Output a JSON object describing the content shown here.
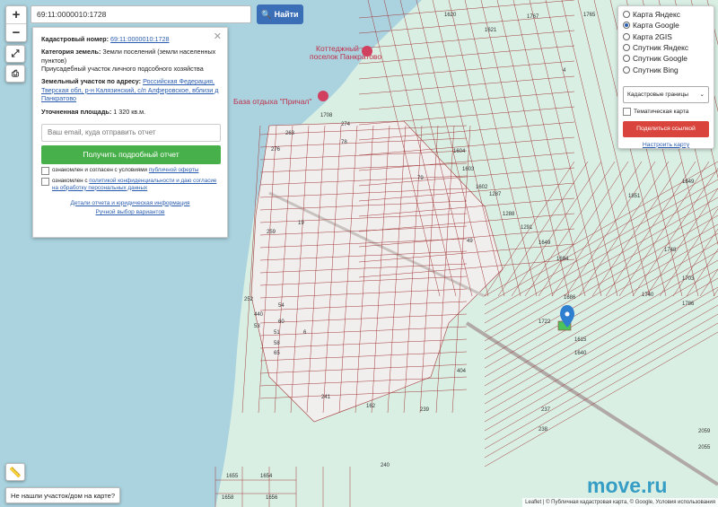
{
  "search": {
    "value": "69:11:0000010:1728",
    "button_label": "Найти"
  },
  "zoom": {
    "in_label": "+",
    "out_label": "−"
  },
  "info": {
    "cadastral_label": "Кадастровый номер:",
    "cadastral_value": "69:11:0000010:1728",
    "category_label": "Категория земель:",
    "category_value": "Земли поселений (земли населенных пунктов)",
    "use_value": "Приусадебный участок личного подсобного хозяйства",
    "address_label": "Земельный участок по адресу:",
    "address_value": "Российская Федерация, Тверская обл, р-н Калязинский, с/п Алферовское, вблизи д Панкратово",
    "area_label": "Уточненная площадь:",
    "area_value": "1 320 кв.м.",
    "email_placeholder": "Ваш email, куда отправить отчет",
    "report_button": "Получить подробный отчет",
    "check1_text": "ознакомлен и согласен с условиями",
    "check1_link": "публичной оферты",
    "check2_text": "ознакомлен с",
    "check2_link": "политикой конфиденциальности и даю согласие на обработку персональных данных",
    "details_link": "Детали отчета и юридическая информация",
    "manual_link": "Ручной выбор вариантов"
  },
  "layers": {
    "options": [
      "Карта Яндекс",
      "Карта Google",
      "Карта 2GIS",
      "Спутник Яндекс",
      "Спутник Google",
      "Спутник Bing"
    ],
    "selected_index": 1,
    "borders_select": "Кадастровые границы",
    "thematic_label": "Тематическая карта",
    "share_button": "Поделиться ссылкой",
    "setup_link": "Настроить карту"
  },
  "map": {
    "poi1": "Коттеджный поселок Панкратово",
    "poi2": "База отдыха \"Причал\"",
    "parcel_numbers": [
      "1620",
      "1621",
      "1767",
      "1765",
      "4",
      "1849",
      "1851",
      "1604",
      "1603",
      "1602",
      "1287",
      "1288",
      "1291",
      "1649",
      "1694",
      "1708",
      "263",
      "276",
      "274",
      "78",
      "79",
      "49",
      "19",
      "259",
      "252",
      "440",
      "53",
      "54",
      "60",
      "51",
      "58",
      "65",
      "6",
      "404",
      "241",
      "162",
      "239",
      "237",
      "238",
      "240",
      "1655",
      "1654",
      "1658",
      "1656",
      "1615",
      "1640",
      "1722",
      "1686",
      "1740",
      "1786",
      "1703",
      "1748",
      "2059",
      "2055"
    ],
    "marker_color": "#2f7fd0"
  },
  "bottom": {
    "not_found": "Не нашли участок/дом на карте?",
    "attribution": "Leaflet | © Публичная кадастровая карта, © Google, Условия использования"
  },
  "watermark": "move.ru",
  "colors": {
    "water": "#aad3df",
    "land": "#d9efe4",
    "parcel_line": "#a33a3a",
    "settlement": "#f1eeee",
    "road": "#b0a9a6"
  }
}
